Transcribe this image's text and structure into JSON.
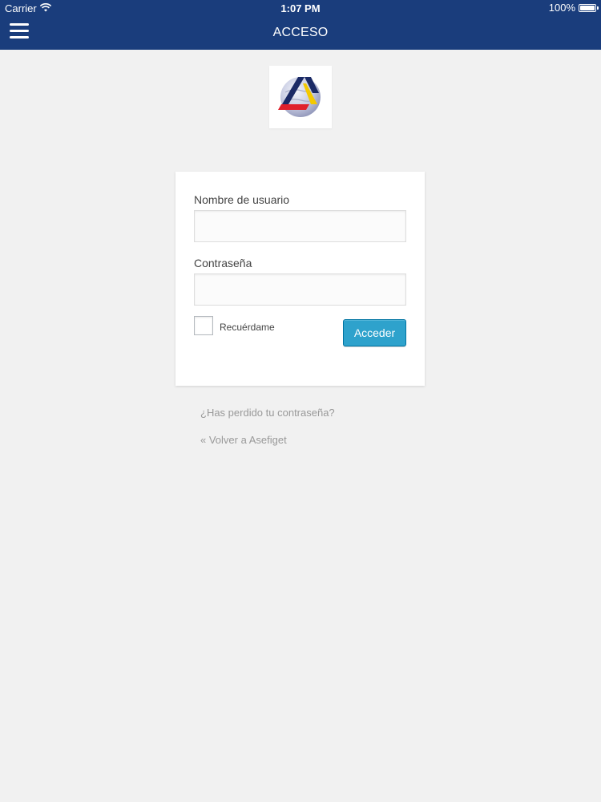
{
  "status_bar": {
    "carrier": "Carrier",
    "time": "1:07 PM",
    "battery": "100%",
    "icons": [
      "wifi-icon",
      "battery-icon"
    ]
  },
  "nav_bar": {
    "title": "ACCESO",
    "menu_icon": "hamburger-menu-icon"
  },
  "logo": {
    "icon": "asefiget-logo"
  },
  "login_form": {
    "username_label": "Nombre de usuario",
    "username_value": "",
    "password_label": "Contraseña",
    "password_value": "",
    "remember_label": "Recuérdame",
    "remember_checked": false,
    "submit_label": "Acceder"
  },
  "links": {
    "lost_password": "¿Has perdido tu contraseña?",
    "back_to_site": "« Volver a Asefiget"
  },
  "colors": {
    "nav_background": "#1a3d7c",
    "page_background": "#f1f1f1",
    "button_background": "#2ea2cc",
    "link_color": "#999999"
  }
}
